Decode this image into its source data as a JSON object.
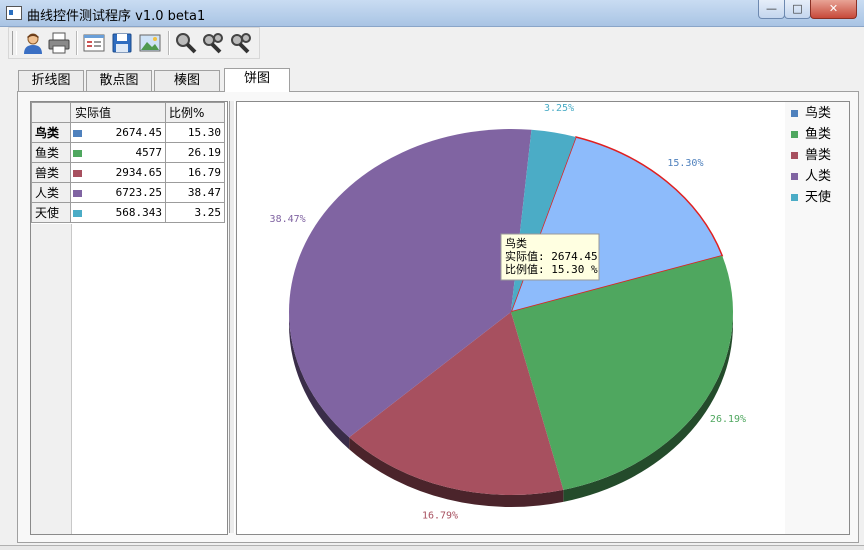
{
  "window": {
    "title": "曲线控件测试程序 v1.0 beta1"
  },
  "titlebar_buttons": {
    "minimize": "—",
    "maximize": "□",
    "close": "✕"
  },
  "toolbar": {
    "buttons": [
      {
        "name": "user-icon"
      },
      {
        "name": "print-icon"
      },
      {
        "name": "form-icon"
      },
      {
        "name": "save-icon"
      },
      {
        "name": "image-icon"
      },
      {
        "name": "zoom-icon"
      },
      {
        "name": "zoom-in-icon"
      },
      {
        "name": "zoom-out-icon"
      }
    ]
  },
  "tabs": [
    {
      "label": "折线图",
      "active": false
    },
    {
      "label": "散点图",
      "active": false
    },
    {
      "label": "楱图",
      "active": false
    },
    {
      "label": "饼图",
      "active": true
    }
  ],
  "table": {
    "headers": [
      "实际值",
      "比例%"
    ],
    "rows": [
      {
        "name": "鸟类",
        "value": "2674.45",
        "pct": "15.30",
        "color": "#4f81bd",
        "selected": true
      },
      {
        "name": "鱼类",
        "value": "4577",
        "pct": "26.19",
        "color": "#4fa75f",
        "selected": false
      },
      {
        "name": "兽类",
        "value": "2934.65",
        "pct": "16.79",
        "color": "#a7505f",
        "selected": false
      },
      {
        "name": "人类",
        "value": "6723.25",
        "pct": "38.47",
        "color": "#8064a2",
        "selected": false
      },
      {
        "name": "天使",
        "value": "568.343",
        "pct": "3.25",
        "color": "#4bacc6",
        "selected": false
      }
    ]
  },
  "chart_data": {
    "type": "pie",
    "categories": [
      "鸟类",
      "鱼类",
      "兽类",
      "人类",
      "天使"
    ],
    "values": [
      2674.45,
      4577,
      2934.65,
      6723.25,
      568.343
    ],
    "labels": [
      "15.30%",
      "26.19%",
      "16.79%",
      "38.47%",
      "3.25%"
    ],
    "colors": [
      "#8dbbfb",
      "#4fa75f",
      "#a7505f",
      "#8064a2",
      "#4bacc6"
    ],
    "highlighted": "鸟类",
    "legend_position": "right",
    "tooltip": {
      "title": "鸟类",
      "line1": "实际值: 2674.45",
      "line2": "比例值: 15.30 %"
    }
  },
  "legend": [
    {
      "label": "鸟类",
      "color": "#4f81bd"
    },
    {
      "label": "鱼类",
      "color": "#4fa75f"
    },
    {
      "label": "兽类",
      "color": "#a7505f"
    },
    {
      "label": "人类",
      "color": "#8064a2"
    },
    {
      "label": "天使",
      "color": "#4bacc6"
    }
  ]
}
